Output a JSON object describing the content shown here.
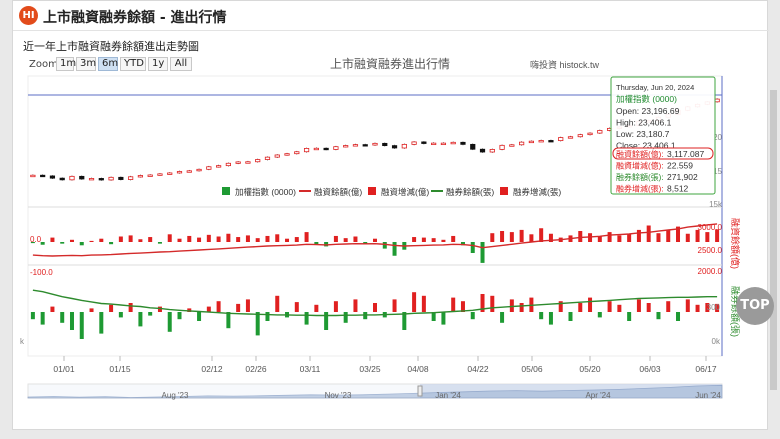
{
  "header": {
    "logo_text": "HI",
    "title": "上市融資融券餘額 - 進出行情"
  },
  "subtitle": "近一年上市融資融券餘額進出走勢圖",
  "zoom": {
    "label": "Zoom",
    "buttons": [
      "1m",
      "3m",
      "6m",
      "YTD",
      "1y",
      "All"
    ],
    "active": "6m"
  },
  "top_button": "TOP",
  "chart_data": {
    "type": "line",
    "title": "上市融資融券進出行情",
    "credit": "嗨投資 histock.tw",
    "x_ticks": [
      "01/01",
      "01/15",
      "02/12",
      "02/26",
      "03/11",
      "03/25",
      "04/08",
      "04/22",
      "05/06",
      "05/20",
      "06/03",
      "06/17"
    ],
    "legend": [
      "加權指數 (0000)",
      "融資餘額(億)",
      "融資增減(億)",
      "融券餘額(張)",
      "融券增減(張)"
    ],
    "colors": {
      "up": "#e02020",
      "down": "#1e9a33",
      "margin_line": "#d42a2a",
      "short_line": "#2e8b2e",
      "border": "#5b6ec6",
      "tooltip_border": "#3fa63f"
    },
    "panes": {
      "margin_axis_labels": [
        "3000.0",
        "2500.0"
      ],
      "margin_side_title": "融資餘額(億)",
      "margin_change_labels": [
        "0.0",
        "-100.0"
      ],
      "short_axis_labels": [
        "2000.0"
      ],
      "short_side_title": "融券餘額(張)",
      "index_axis_partial": [
        "20",
        "15",
        "15k"
      ],
      "short_axis_partial": [
        "300",
        "0k"
      ],
      "left_axis_partial": "k"
    },
    "index": [
      17931,
      17880,
      17720,
      17600,
      17850,
      17660,
      17700,
      17590,
      17780,
      17620,
      17820,
      17910,
      17950,
      18030,
      18096,
      18200,
      18250,
      18356,
      18540,
      18620,
      18790,
      18890,
      18900,
      19060,
      19231,
      19389,
      19480,
      19620,
      19860,
      19870,
      19785,
      19984,
      20067,
      20133,
      20100,
      20222,
      20060,
      19890,
      20149,
      20326,
      20212,
      20240,
      20240,
      20297,
      20150,
      19800,
      19600,
      19787,
      20080,
      20120,
      20310,
      20380,
      20430,
      20420,
      20640,
      20700,
      20850,
      20960,
      21150,
      21300,
      21400,
      21510,
      21800,
      21860,
      22100,
      22300,
      22600,
      22850,
      23030,
      23210,
      23406
    ],
    "margin_balance": [
      2570,
      2560,
      2555,
      2560,
      2565,
      2560,
      2570,
      2575,
      2580,
      2590,
      2600,
      2605,
      2615,
      2625,
      2630,
      2640,
      2650,
      2660,
      2670,
      2680,
      2690,
      2700,
      2710,
      2720,
      2730,
      2735,
      2740,
      2745,
      2760,
      2755,
      2750,
      2760,
      2765,
      2770,
      2768,
      2770,
      2760,
      2740,
      2730,
      2735,
      2740,
      2745,
      2750,
      2760,
      2755,
      2740,
      2700,
      2720,
      2740,
      2760,
      2780,
      2800,
      2820,
      2830,
      2840,
      2860,
      2880,
      2890,
      2900,
      2920,
      2930,
      2940,
      2960,
      2970,
      2990,
      3010,
      3030,
      3060,
      3080,
      3100,
      3117
    ],
    "margin_change": [
      -2,
      -5,
      8,
      -3,
      4,
      -6,
      2,
      6,
      -4,
      10,
      12,
      5,
      9,
      -3,
      14,
      6,
      11,
      8,
      13,
      10,
      15,
      9,
      12,
      7,
      11,
      14,
      6,
      9,
      18,
      -5,
      -8,
      11,
      7,
      10,
      -4,
      6,
      -12,
      -25,
      -14,
      9,
      8,
      7,
      4,
      11,
      -6,
      -20,
      -38,
      16,
      20,
      18,
      22,
      14,
      25,
      15,
      8,
      12,
      20,
      16,
      10,
      18,
      12,
      14,
      22,
      30,
      16,
      21,
      28,
      15,
      22,
      18,
      23
    ],
    "short_balance": [
      293,
      288,
      280,
      272,
      266,
      260,
      255,
      250,
      248,
      245,
      242,
      240,
      236,
      234,
      230,
      228,
      226,
      224,
      222,
      220,
      218,
      217,
      216,
      215,
      214,
      213,
      213,
      212,
      212,
      211,
      211,
      211,
      212,
      212,
      213,
      213,
      214,
      215,
      216,
      218,
      219,
      220,
      222,
      224,
      226,
      228,
      232,
      236,
      238,
      240,
      242,
      244,
      246,
      248,
      250,
      252,
      254,
      256,
      258,
      260,
      262,
      264,
      266,
      267,
      268,
      269,
      270,
      270,
      271,
      272,
      272
    ],
    "short_change": [
      -8,
      -14,
      6,
      -12,
      -20,
      -30,
      4,
      -24,
      8,
      -6,
      10,
      -16,
      -4,
      6,
      -22,
      -8,
      4,
      -10,
      6,
      12,
      -18,
      9,
      14,
      -26,
      -10,
      18,
      -6,
      11,
      -14,
      8,
      -20,
      12,
      -12,
      14,
      -8,
      10,
      -6,
      14,
      -20,
      22,
      18,
      -10,
      -14,
      16,
      12,
      -8,
      20,
      18,
      -12,
      14,
      10,
      16,
      -8,
      -14,
      12,
      -10,
      10,
      16,
      -6,
      12,
      8,
      -10,
      14,
      10,
      -8,
      12,
      -10,
      14,
      8,
      10,
      9
    ],
    "tooltip": {
      "date": "Thursday, Jun 20, 2024",
      "series": "加權指數 (0000)",
      "open": "Open: 23,196.69",
      "high": "High: 23,406.1",
      "low": "Low: 23,180.7",
      "close": "Close: 23,406.1",
      "margin_balance_label": "融資餘額(億):",
      "margin_balance_value": "3,117.087",
      "margin_change_label": "融資增減(億):",
      "margin_change_value": "22.559",
      "short_balance_label": "融券餘額(張):",
      "short_balance_value": "271,902",
      "short_change_label": "融券增減(張):",
      "short_change_value": "8,512"
    },
    "navigator": {
      "labels": [
        "Aug '23",
        "Nov '23",
        "Jan '24",
        "Apr '24",
        "Jun '24"
      ],
      "series": [
        16600,
        16900,
        16500,
        16800,
        16300,
        16600,
        16900,
        17200,
        17100,
        17300,
        17600,
        17900,
        17700,
        17900,
        18300,
        18700,
        19200,
        19600,
        20100,
        20300,
        20000,
        20400,
        20700,
        21000,
        21600,
        22200,
        23000,
        23406
      ]
    }
  }
}
